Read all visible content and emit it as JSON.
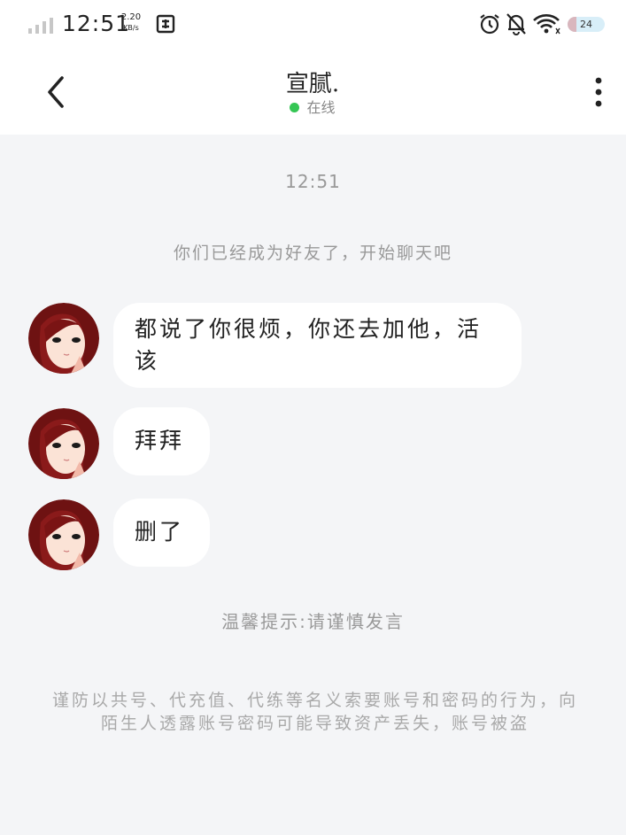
{
  "status_bar": {
    "time": "12:51",
    "net_speed_value": "2.20",
    "net_speed_unit": "KB/s",
    "battery_level": "24",
    "icons": [
      "signal-icon",
      "sim-icon",
      "alarm-icon",
      "bell-off-icon",
      "wifi-icon",
      "battery-icon"
    ]
  },
  "header": {
    "title": "宣腻.",
    "status_text": "在线",
    "status_color": "#35c654"
  },
  "chat": {
    "timestamp": "12:51",
    "system_message": "你们已经成为好友了，开始聊天吧",
    "messages": [
      {
        "text": "都说了你很烦，你还去加他，活该"
      },
      {
        "text": "拜拜"
      },
      {
        "text": "删了"
      }
    ],
    "tip": "温馨提示:请谨慎发言",
    "warning": "谨防以共号、代充值、代练等名义索要账号和密码的行为，向陌生人透露账号密码可能导致资产丢失，账号被盗"
  },
  "colors": {
    "background": "#f4f5f7",
    "bubble": "#ffffff",
    "online": "#35c654"
  }
}
